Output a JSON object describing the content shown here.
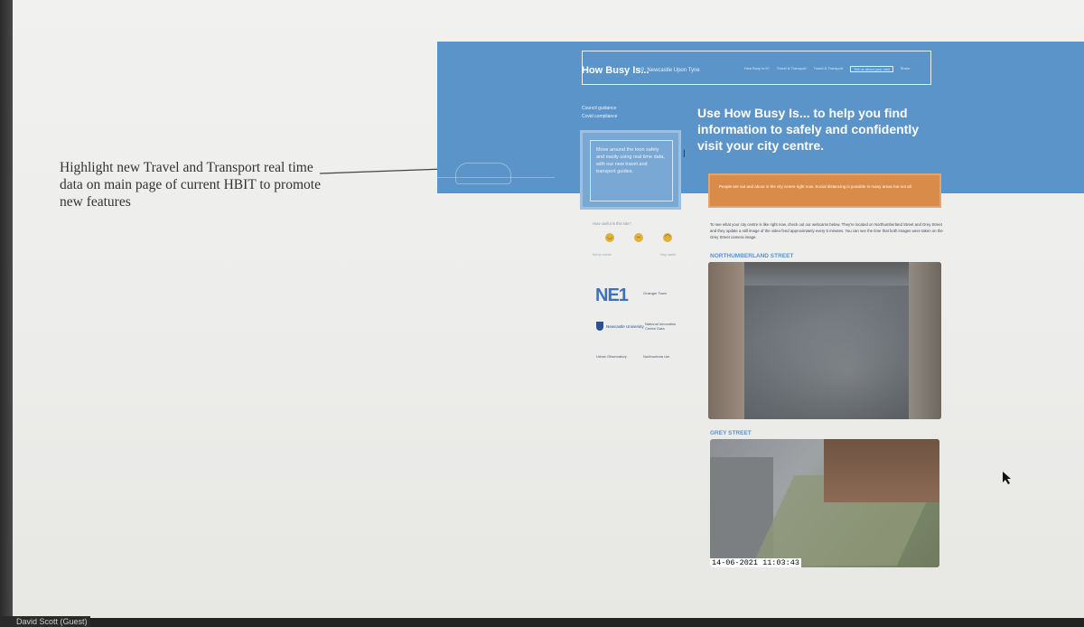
{
  "annotation": {
    "text": "Highlight new Travel and Transport real time data on main page of current HBIT to promote new features"
  },
  "site": {
    "logo": "How Busy Is...",
    "location": "Newcastle Upon Tyne",
    "nav": [
      "How Busy Is It?",
      "Travel & Transport",
      "Travel & Transport",
      "Tell us about your visit",
      "Share"
    ],
    "side_links": [
      "Council guidance",
      "Covid compliance"
    ],
    "hero_title": "Use How Busy Is... to help you find information to safely and confidently visit your city centre.",
    "travel_card": "Move around the toon safely and easily using real time data, with our new travel and transport guides.",
    "banner": "People are out and about in the city centre right now. Social distancing is possible in many areas but not all.",
    "intro": "To see what your city centre is like right now, check out our webcams below. They're located on Northumberland Street and Grey Street and they update a still image of the video feed approximately every 5 minutes. You can see the time that both images were taken on the Grey Street camera image.",
    "feedback_question": "How useful is this site?",
    "feedback_low": "Not so useful",
    "feedback_high": "Very useful",
    "faces": [
      "smile",
      "neutral",
      "frown"
    ],
    "partners": [
      "NE1",
      "Grainger Town",
      "Newcastle University",
      "National Innovation Centre Data",
      "Urban Observatory",
      "Northumbria Uni"
    ],
    "cam1_title": "NORTHUMBERLAND STREET",
    "cam2_title": "GREY STREET",
    "timestamp": "14-06-2021 11:03:43"
  },
  "meeting": {
    "participant": "David Scott (Guest)"
  },
  "colors": {
    "hero_blue": "#5b94c9",
    "banner_orange": "#d98b4a"
  }
}
